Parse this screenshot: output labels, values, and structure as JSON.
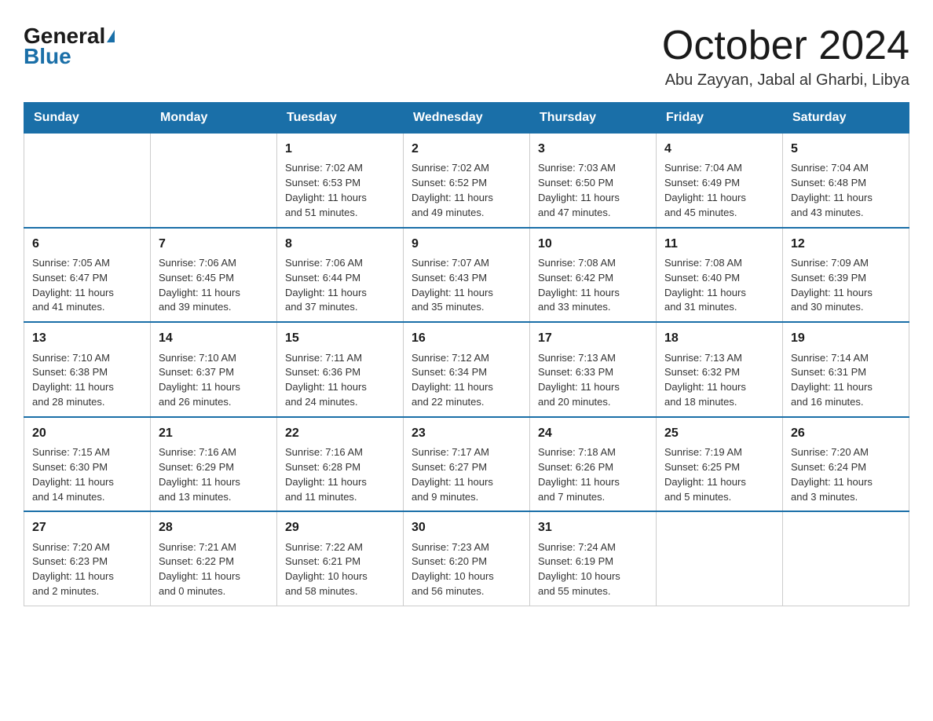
{
  "logo": {
    "general": "General",
    "blue": "Blue"
  },
  "header": {
    "month": "October 2024",
    "location": "Abu Zayyan, Jabal al Gharbi, Libya"
  },
  "weekdays": [
    "Sunday",
    "Monday",
    "Tuesday",
    "Wednesday",
    "Thursday",
    "Friday",
    "Saturday"
  ],
  "weeks": [
    [
      {
        "day": "",
        "info": ""
      },
      {
        "day": "",
        "info": ""
      },
      {
        "day": "1",
        "info": "Sunrise: 7:02 AM\nSunset: 6:53 PM\nDaylight: 11 hours\nand 51 minutes."
      },
      {
        "day": "2",
        "info": "Sunrise: 7:02 AM\nSunset: 6:52 PM\nDaylight: 11 hours\nand 49 minutes."
      },
      {
        "day": "3",
        "info": "Sunrise: 7:03 AM\nSunset: 6:50 PM\nDaylight: 11 hours\nand 47 minutes."
      },
      {
        "day": "4",
        "info": "Sunrise: 7:04 AM\nSunset: 6:49 PM\nDaylight: 11 hours\nand 45 minutes."
      },
      {
        "day": "5",
        "info": "Sunrise: 7:04 AM\nSunset: 6:48 PM\nDaylight: 11 hours\nand 43 minutes."
      }
    ],
    [
      {
        "day": "6",
        "info": "Sunrise: 7:05 AM\nSunset: 6:47 PM\nDaylight: 11 hours\nand 41 minutes."
      },
      {
        "day": "7",
        "info": "Sunrise: 7:06 AM\nSunset: 6:45 PM\nDaylight: 11 hours\nand 39 minutes."
      },
      {
        "day": "8",
        "info": "Sunrise: 7:06 AM\nSunset: 6:44 PM\nDaylight: 11 hours\nand 37 minutes."
      },
      {
        "day": "9",
        "info": "Sunrise: 7:07 AM\nSunset: 6:43 PM\nDaylight: 11 hours\nand 35 minutes."
      },
      {
        "day": "10",
        "info": "Sunrise: 7:08 AM\nSunset: 6:42 PM\nDaylight: 11 hours\nand 33 minutes."
      },
      {
        "day": "11",
        "info": "Sunrise: 7:08 AM\nSunset: 6:40 PM\nDaylight: 11 hours\nand 31 minutes."
      },
      {
        "day": "12",
        "info": "Sunrise: 7:09 AM\nSunset: 6:39 PM\nDaylight: 11 hours\nand 30 minutes."
      }
    ],
    [
      {
        "day": "13",
        "info": "Sunrise: 7:10 AM\nSunset: 6:38 PM\nDaylight: 11 hours\nand 28 minutes."
      },
      {
        "day": "14",
        "info": "Sunrise: 7:10 AM\nSunset: 6:37 PM\nDaylight: 11 hours\nand 26 minutes."
      },
      {
        "day": "15",
        "info": "Sunrise: 7:11 AM\nSunset: 6:36 PM\nDaylight: 11 hours\nand 24 minutes."
      },
      {
        "day": "16",
        "info": "Sunrise: 7:12 AM\nSunset: 6:34 PM\nDaylight: 11 hours\nand 22 minutes."
      },
      {
        "day": "17",
        "info": "Sunrise: 7:13 AM\nSunset: 6:33 PM\nDaylight: 11 hours\nand 20 minutes."
      },
      {
        "day": "18",
        "info": "Sunrise: 7:13 AM\nSunset: 6:32 PM\nDaylight: 11 hours\nand 18 minutes."
      },
      {
        "day": "19",
        "info": "Sunrise: 7:14 AM\nSunset: 6:31 PM\nDaylight: 11 hours\nand 16 minutes."
      }
    ],
    [
      {
        "day": "20",
        "info": "Sunrise: 7:15 AM\nSunset: 6:30 PM\nDaylight: 11 hours\nand 14 minutes."
      },
      {
        "day": "21",
        "info": "Sunrise: 7:16 AM\nSunset: 6:29 PM\nDaylight: 11 hours\nand 13 minutes."
      },
      {
        "day": "22",
        "info": "Sunrise: 7:16 AM\nSunset: 6:28 PM\nDaylight: 11 hours\nand 11 minutes."
      },
      {
        "day": "23",
        "info": "Sunrise: 7:17 AM\nSunset: 6:27 PM\nDaylight: 11 hours\nand 9 minutes."
      },
      {
        "day": "24",
        "info": "Sunrise: 7:18 AM\nSunset: 6:26 PM\nDaylight: 11 hours\nand 7 minutes."
      },
      {
        "day": "25",
        "info": "Sunrise: 7:19 AM\nSunset: 6:25 PM\nDaylight: 11 hours\nand 5 minutes."
      },
      {
        "day": "26",
        "info": "Sunrise: 7:20 AM\nSunset: 6:24 PM\nDaylight: 11 hours\nand 3 minutes."
      }
    ],
    [
      {
        "day": "27",
        "info": "Sunrise: 7:20 AM\nSunset: 6:23 PM\nDaylight: 11 hours\nand 2 minutes."
      },
      {
        "day": "28",
        "info": "Sunrise: 7:21 AM\nSunset: 6:22 PM\nDaylight: 11 hours\nand 0 minutes."
      },
      {
        "day": "29",
        "info": "Sunrise: 7:22 AM\nSunset: 6:21 PM\nDaylight: 10 hours\nand 58 minutes."
      },
      {
        "day": "30",
        "info": "Sunrise: 7:23 AM\nSunset: 6:20 PM\nDaylight: 10 hours\nand 56 minutes."
      },
      {
        "day": "31",
        "info": "Sunrise: 7:24 AM\nSunset: 6:19 PM\nDaylight: 10 hours\nand 55 minutes."
      },
      {
        "day": "",
        "info": ""
      },
      {
        "day": "",
        "info": ""
      }
    ]
  ]
}
